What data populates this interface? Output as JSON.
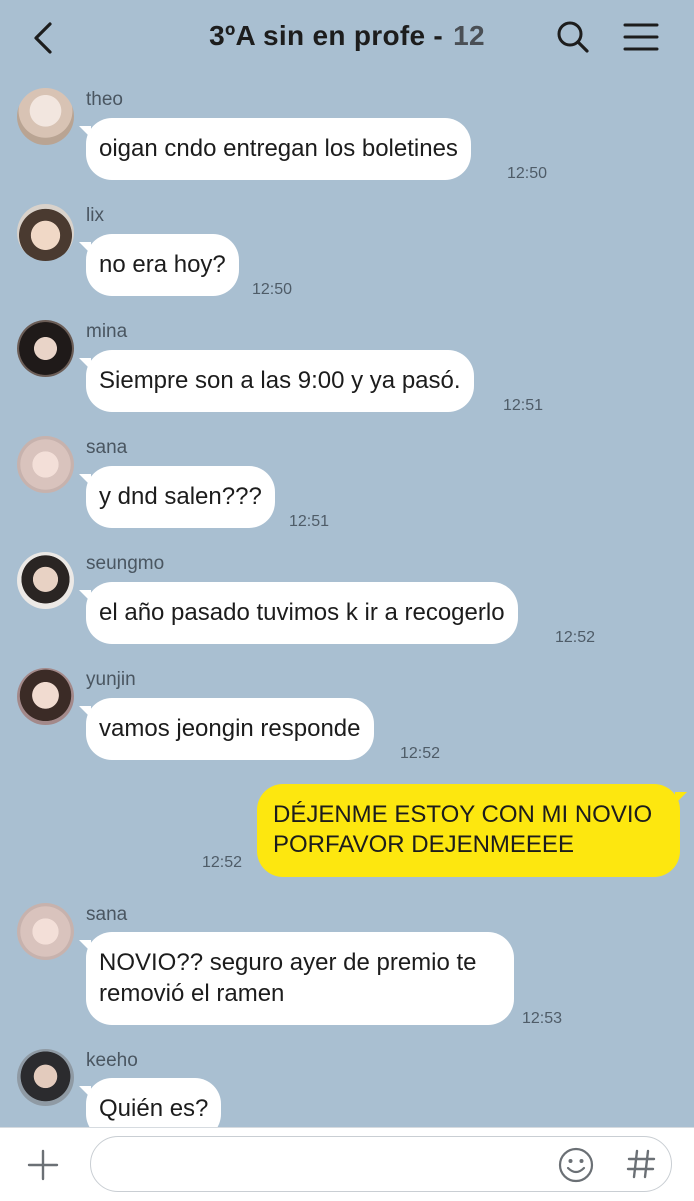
{
  "header": {
    "title": "3ºA sin en profe - ",
    "member_count": "12",
    "back_icon": "chevron-left-icon",
    "search_icon": "search-icon",
    "menu_icon": "hamburger-menu-icon"
  },
  "colors": {
    "chat_background": "#a9bfd1",
    "incoming_bubble": "#ffffff",
    "outgoing_bubble": "#fde70f"
  },
  "messages": [
    {
      "sender": "theo",
      "text": "oigan cndo entregan los boletines",
      "time": "12:50"
    },
    {
      "sender": "lix",
      "text": "no era hoy?",
      "time": "12:50"
    },
    {
      "sender": "mina",
      "text": "Siempre son a las 9:00 y ya pasó.",
      "time": "12:51"
    },
    {
      "sender": "sana",
      "text": "y dnd salen???",
      "time": "12:51"
    },
    {
      "sender": "seungmo",
      "text": "el año pasado tuvimos k ir a recogerlo",
      "time": "12:52"
    },
    {
      "sender": "yunjin",
      "text": "vamos jeongin responde",
      "time": "12:52"
    },
    {
      "sender": "sana",
      "text_line1": "NOVIO?? seguro ayer de premio te",
      "text_line2": "removió el ramen",
      "time": "12:53"
    },
    {
      "sender": "keeho",
      "text": "Quién es?"
    }
  ],
  "my_message": {
    "line1": "DÉJENME ESTOY CON MI NOVIO",
    "line2": "PORFAVOR DEJENMEEEE",
    "time": "12:52"
  },
  "footer": {
    "plus_icon": "plus-icon",
    "emoji_icon": "emoji-icon",
    "hash_icon": "hash-icon",
    "input_value": ""
  }
}
